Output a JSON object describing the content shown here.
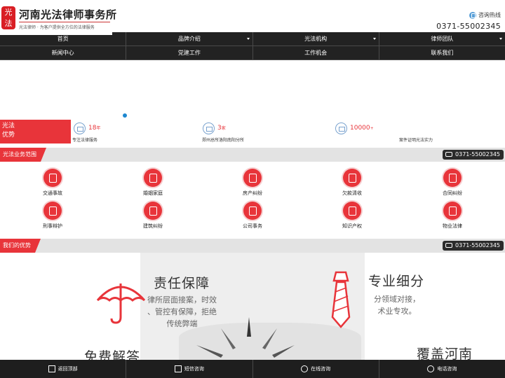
{
  "header": {
    "logo_mark": "光法",
    "site_title": "河南光法律师事务所",
    "tagline": "光法律师 · 为客户提供全方位的法律服务",
    "hotline_label": "咨询热线",
    "hotline_number": "0371-55002345"
  },
  "nav": {
    "row1": [
      {
        "label": "首页",
        "dropdown": false
      },
      {
        "label": "品牌介绍",
        "dropdown": true
      },
      {
        "label": "光法机构",
        "dropdown": true
      },
      {
        "label": "律师团队",
        "dropdown": true
      }
    ],
    "row2": [
      {
        "label": "新闻中心"
      },
      {
        "label": "党建工作"
      },
      {
        "label": "工作机会"
      },
      {
        "label": "联系我们"
      }
    ]
  },
  "stats": {
    "label_line1": "光法",
    "label_line2": "优势",
    "items": [
      {
        "number": "18",
        "unit": "年",
        "desc": "专注法律服务",
        "icon": "building-icon"
      },
      {
        "number": "3",
        "unit": "家",
        "desc": "郑州总所洛阳南阳分所",
        "icon": "person-icon"
      },
      {
        "number": "10000",
        "unit": "+",
        "desc": "案件证明光法实力",
        "icon": "case-icon"
      }
    ]
  },
  "services_section": {
    "title": "光法业务范围",
    "phone": "0371-55002345"
  },
  "services": [
    {
      "label": "交通事故",
      "icon": "traffic-icon"
    },
    {
      "label": "婚姻家庭",
      "icon": "heart-icon"
    },
    {
      "label": "房产纠纷",
      "icon": "house-icon"
    },
    {
      "label": "欠款清收",
      "icon": "money-icon"
    },
    {
      "label": "合同纠纷",
      "icon": "contract-icon"
    },
    {
      "label": "刑事辩护",
      "icon": "handcuff-icon"
    },
    {
      "label": "建筑纠纷",
      "icon": "worker-icon"
    },
    {
      "label": "公司事务",
      "icon": "book-icon"
    },
    {
      "label": "知识产权",
      "icon": "brain-icon"
    },
    {
      "label": "物业法律",
      "icon": "property-icon"
    }
  ],
  "advantages_section": {
    "title": "我们的优势",
    "phone": "0371-55002345",
    "blocks": {
      "responsibility": {
        "title": "责任保障",
        "line1": "律所层面接案，时效",
        "line2": "、管控有保障，拒绝",
        "line3": "传统弊端"
      },
      "specialized": {
        "title": "专业细分",
        "line1": "分领域对接，",
        "line2": "术业专攻。"
      },
      "free": {
        "title": "免费解答"
      },
      "coverage": {
        "title": "覆盖河南"
      }
    }
  },
  "bottom_bar": [
    {
      "label": "返回顶部",
      "icon": "home-icon"
    },
    {
      "label": "短信咨询",
      "icon": "sms-icon"
    },
    {
      "label": "在线咨询",
      "icon": "chat-icon"
    },
    {
      "label": "电话咨询",
      "icon": "phone-icon"
    }
  ],
  "colors": {
    "brand_red": "#e8343a",
    "nav_dark": "#1a1a1a",
    "accent_blue": "#1e88d0"
  }
}
